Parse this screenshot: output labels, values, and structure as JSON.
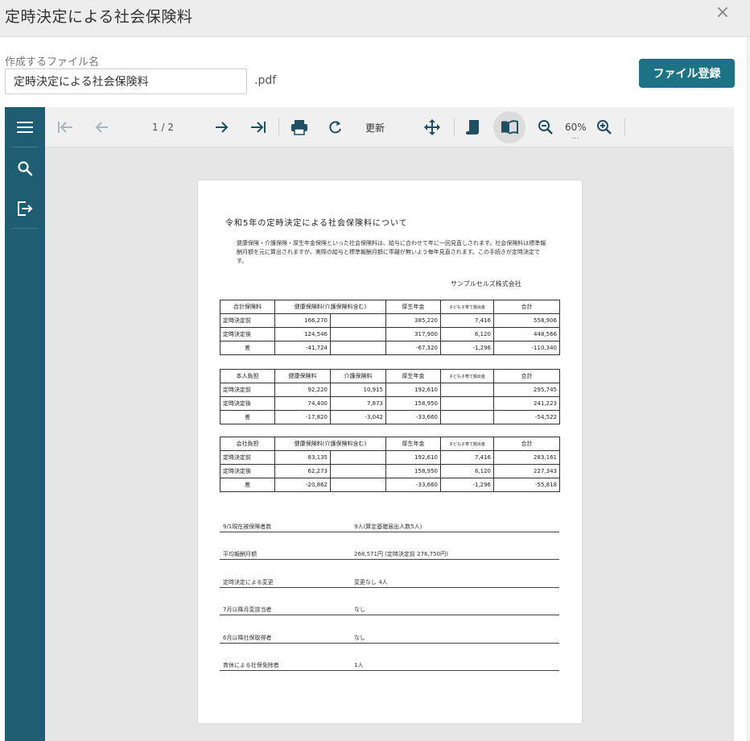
{
  "dialog": {
    "title": "定時決定による社会保険料",
    "close": "×"
  },
  "filename": {
    "label": "作成するファイル名",
    "value": "定時決定による社会保険料",
    "extension": ".pdf"
  },
  "register_button": "ファイル登録",
  "toolbar": {
    "page_indicator": "1 / 2",
    "refresh_label": "更新",
    "zoom": "60%",
    "zoom_more": "..."
  },
  "document": {
    "title": "令和5年の定時決定による社会保険料について",
    "intro": "健康保険・介護保険・厚生年金保険といった社会保険料は、給与に合わせて年に一回見直しされます。社会保険料は標準報酬月額を元に算出されますが、実際の給与と標準報酬月額に乖離が無いよう毎年見直されます。この手続きが定時決定です。",
    "company": "サンプルセルズ株式会社",
    "tables": [
      {
        "headers": [
          "合計保険料",
          "健康保険料(介護保険料含む)",
          "",
          "厚生年金",
          "子ども子育て拠出金",
          "合計"
        ],
        "rows": [
          [
            "定時決定前",
            "166,270",
            "",
            "385,220",
            "7,416",
            "558,906"
          ],
          [
            "定時決定後",
            "124,546",
            "",
            "317,900",
            "6,120",
            "448,566"
          ],
          [
            "差",
            "-41,724",
            "",
            "-67,320",
            "-1,296",
            "-110,340"
          ]
        ]
      },
      {
        "headers": [
          "本人負担",
          "健康保険料",
          "介護保険料",
          "厚生年金",
          "子ども子育て拠出金",
          "合計"
        ],
        "rows": [
          [
            "定時決定前",
            "92,220",
            "10,915",
            "192,610",
            "",
            "295,745"
          ],
          [
            "定時決定後",
            "74,400",
            "7,873",
            "158,950",
            "",
            "241,223"
          ],
          [
            "差",
            "-17,820",
            "-3,042",
            "-33,660",
            "",
            "-54,522"
          ]
        ]
      },
      {
        "headers": [
          "会社負担",
          "健康保険料(介護保険料含む)",
          "",
          "厚生年金",
          "子ども子育て拠出金",
          "合計"
        ],
        "rows": [
          [
            "定時決定前",
            "83,135",
            "",
            "192,610",
            "7,416",
            "283,161"
          ],
          [
            "定時決定後",
            "62,273",
            "",
            "158,950",
            "6,120",
            "227,343"
          ],
          [
            "差",
            "-20,862",
            "",
            "-33,660",
            "-1,296",
            "-55,818"
          ]
        ]
      }
    ],
    "info": [
      {
        "label": "9/1現在被保険者数",
        "value": "9人(算定基礎届出人数5人)"
      },
      {
        "label": "平均報酬月額",
        "value": "268,571円 (定時決定前 276,750円)"
      },
      {
        "label": "定時決定による変更",
        "value": "変更なし 4人"
      },
      {
        "label": "7月以降月変該当者",
        "value": "なし"
      },
      {
        "label": "6月以降社保取得者",
        "value": "なし"
      },
      {
        "label": "育休による社保免除者",
        "value": "1人"
      }
    ]
  },
  "colors": {
    "primary": "#1d7385",
    "sidebar": "#1f5e72"
  }
}
